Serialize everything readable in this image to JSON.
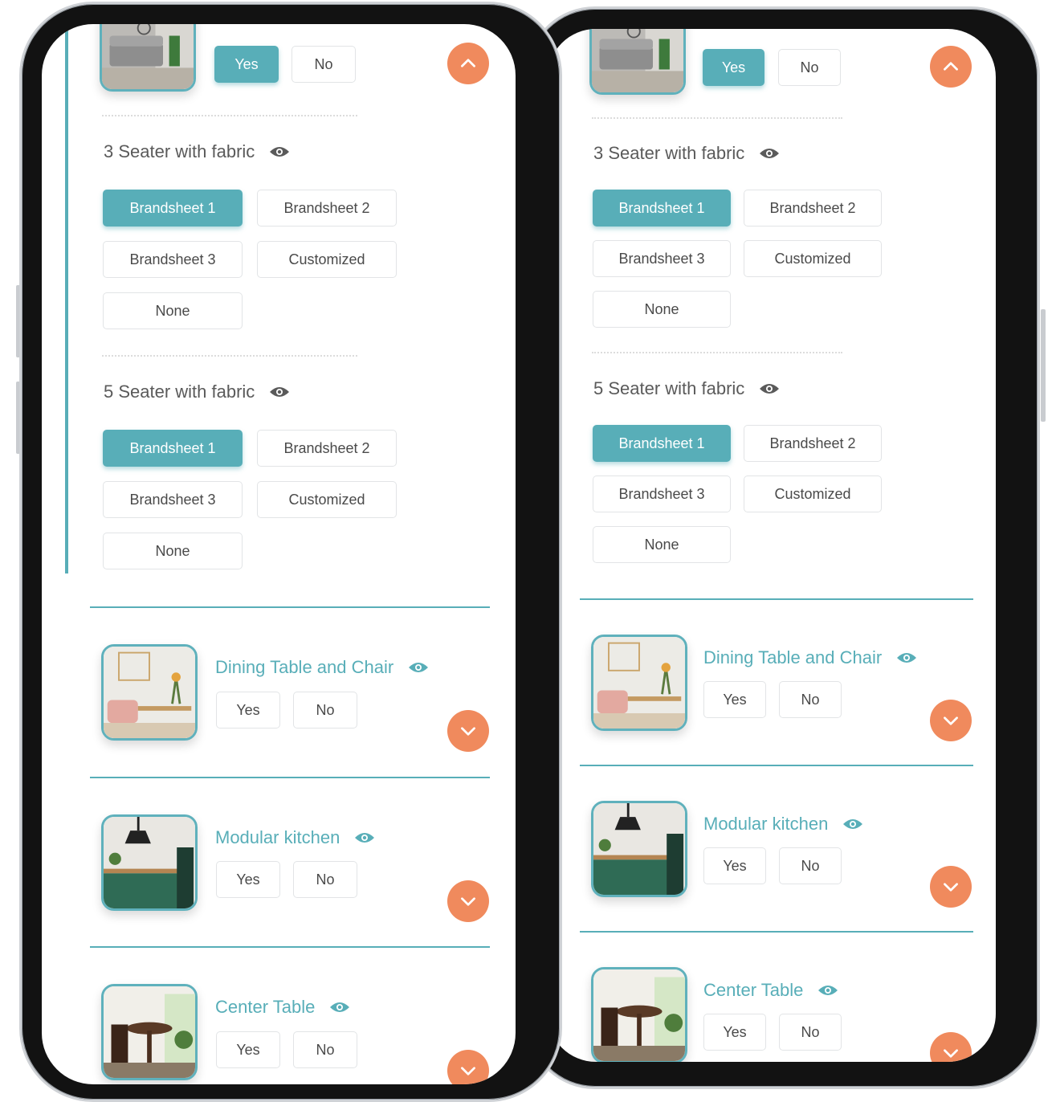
{
  "colors": {
    "accent": "#58aeb8",
    "action": "#f08a5d",
    "frame": "#121212"
  },
  "icons": {
    "eye": "eye-icon",
    "up": "chevron-up-icon",
    "down": "chevron-down-icon"
  },
  "phones": [
    {
      "sofa": {
        "yes": "Yes",
        "no": "No"
      },
      "seater3": {
        "title": "3 Seater with fabric",
        "options": [
          "Brandsheet 1",
          "Brandsheet 2",
          "Brandsheet 3",
          "Customized",
          "None"
        ],
        "selected": "Brandsheet 1"
      },
      "seater5": {
        "title": "5 Seater with fabric",
        "options": [
          "Brandsheet 1",
          "Brandsheet 2",
          "Brandsheet 3",
          "Customized",
          "None"
        ],
        "selected": "Brandsheet 1"
      },
      "items": [
        {
          "title": "Dining Table and Chair",
          "yes": "Yes",
          "no": "No"
        },
        {
          "title": "Modular kitchen",
          "yes": "Yes",
          "no": "No"
        },
        {
          "title": "Center Table",
          "yes": "Yes",
          "no": "No"
        }
      ]
    },
    {
      "sofa": {
        "yes": "Yes",
        "no": "No"
      },
      "seater3": {
        "title": "3 Seater with fabric",
        "options": [
          "Brandsheet 1",
          "Brandsheet 2",
          "Brandsheet 3",
          "Customized",
          "None"
        ],
        "selected": "Brandsheet 1"
      },
      "seater5": {
        "title": "5 Seater with fabric",
        "options": [
          "Brandsheet 1",
          "Brandsheet 2",
          "Brandsheet 3",
          "Customized",
          "None"
        ],
        "selected": "Brandsheet 1"
      },
      "items": [
        {
          "title": "Dining Table and Chair",
          "yes": "Yes",
          "no": "No"
        },
        {
          "title": "Modular kitchen",
          "yes": "Yes",
          "no": "No"
        },
        {
          "title": "Center Table",
          "yes": "Yes",
          "no": "No"
        }
      ]
    }
  ]
}
